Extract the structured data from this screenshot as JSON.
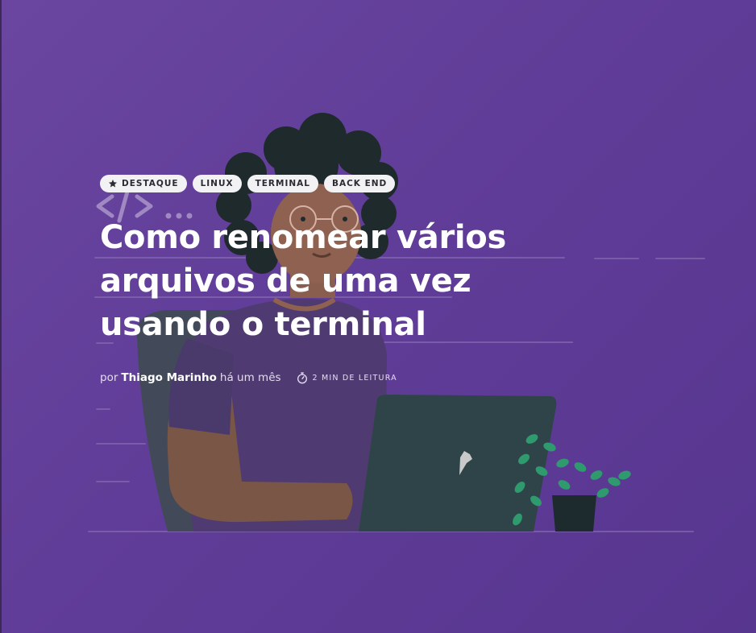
{
  "tags": [
    {
      "label": "DESTAQUE",
      "icon": "star-icon"
    },
    {
      "label": "LINUX"
    },
    {
      "label": "TERMINAL"
    },
    {
      "label": "BACK END"
    }
  ],
  "title": "Como renomear vários arquivos de uma vez usando o terminal",
  "meta": {
    "by": "por",
    "author": "Thiago Marinho",
    "time_ago": "há um mês",
    "reading_time": "2 MIN DE LEITURA",
    "reading_icon": "stopwatch-icon"
  },
  "illustration": {
    "code_symbol": "</>...",
    "description_icon": "woman-with-laptop-illustration"
  },
  "colors": {
    "background": "#633f9b",
    "tag_background": "#f2f2f4",
    "title": "#ffffff"
  }
}
